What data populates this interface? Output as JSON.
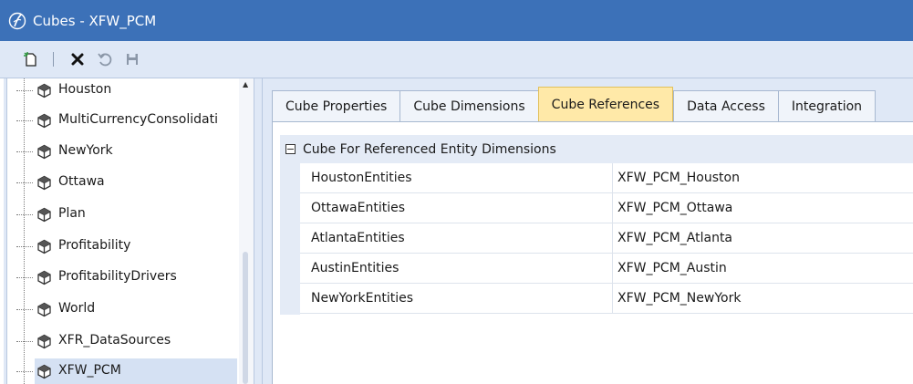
{
  "window": {
    "title": "Cubes - XFW_PCM"
  },
  "toolbar": {
    "buttons": [
      {
        "icon": "new-icon",
        "enabled": true
      },
      {
        "icon": "delete-icon",
        "enabled": true
      },
      {
        "icon": "revert-icon",
        "enabled": false
      },
      {
        "icon": "save-icon",
        "enabled": false
      }
    ]
  },
  "tree": {
    "items": [
      {
        "label": "Houston"
      },
      {
        "label": "MultiCurrencyConsolidati"
      },
      {
        "label": "NewYork"
      },
      {
        "label": "Ottawa"
      },
      {
        "label": "Plan"
      },
      {
        "label": "Profitability"
      },
      {
        "label": "ProfitabilityDrivers"
      },
      {
        "label": "World"
      },
      {
        "label": "XFR_DataSources"
      },
      {
        "label": "XFW_PCM",
        "selected": true
      }
    ]
  },
  "tabs": [
    {
      "label": "Cube Properties"
    },
    {
      "label": "Cube Dimensions"
    },
    {
      "label": "Cube References",
      "active": true
    },
    {
      "label": "Data Access"
    },
    {
      "label": "Integration"
    }
  ],
  "grid": {
    "group_label": "Cube For Referenced Entity Dimensions",
    "rows": [
      {
        "name": "HoustonEntities",
        "value": "XFW_PCM_Houston"
      },
      {
        "name": "OttawaEntities",
        "value": "XFW_PCM_Ottawa"
      },
      {
        "name": "AtlantaEntities",
        "value": "XFW_PCM_Atlanta"
      },
      {
        "name": "AustinEntities",
        "value": "XFW_PCM_Austin"
      },
      {
        "name": "NewYorkEntities",
        "value": "XFW_PCM_NewYork"
      }
    ]
  },
  "colors": {
    "titlebar": "#3c71b8",
    "active_tab": "#ffe9a8",
    "selection": "#d5e1f3",
    "panel": "#dfe8f6"
  }
}
